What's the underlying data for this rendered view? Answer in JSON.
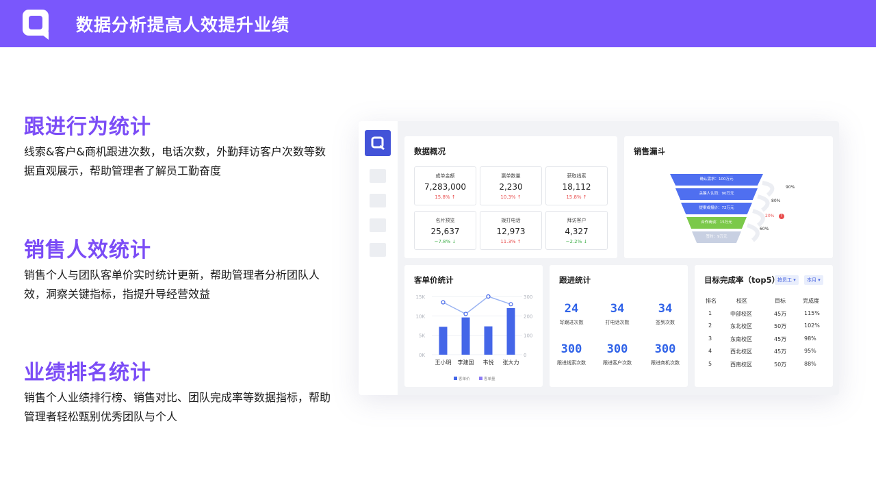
{
  "header": {
    "title": "数据分析提高人效提升业绩"
  },
  "sections": [
    {
      "title": "跟进行为统计",
      "desc": "线索&客户&商机跟进次数，电话次数，外勤拜访客户次数等数据直观展示，帮助管理者了解员工勤奋度"
    },
    {
      "title": "销售人效统计",
      "desc": "销售个人与团队客单价实时统计更新，帮助管理者分析团队人效，洞察关键指标，指提升导经营效益"
    },
    {
      "title": "业绩排名统计",
      "desc": "销售个人业绩排行榜、销售对比、团队完成率等数据指标，帮助管理者轻松甄别优秀团队与个人"
    }
  ],
  "overview": {
    "title": "数据概况",
    "kpis": [
      {
        "label": "成单金额",
        "value": "7,283,000",
        "change": "15.8%",
        "dir": "up"
      },
      {
        "label": "赢单数量",
        "value": "2,230",
        "change": "10.3%",
        "dir": "up"
      },
      {
        "label": "获取线索",
        "value": "18,112",
        "change": "15.8%",
        "dir": "up"
      },
      {
        "label": "名片预览",
        "value": "25,637",
        "change": "−7.8%",
        "dir": "down"
      },
      {
        "label": "拨打电话",
        "value": "12,973",
        "change": "11.3%",
        "dir": "up"
      },
      {
        "label": "拜访客户",
        "value": "4,327",
        "change": "−2.2%",
        "dir": "down"
      }
    ]
  },
  "funnel": {
    "title": "销售漏斗",
    "stages": [
      {
        "label": "确认需求：100万元",
        "color": "#4f6ff0"
      },
      {
        "label": "关键人认同：90万元",
        "color": "#4f6ff0"
      },
      {
        "label": "提案或报价：72万元",
        "color": "#4f6ff0"
      },
      {
        "label": "合作商谈：15万元",
        "color": "#7bc94a"
      },
      {
        "label": "签约：9万元",
        "color": "#c8d0e2"
      }
    ],
    "percents": [
      "90%",
      "80%",
      "20%",
      "60%"
    ]
  },
  "chart_data": {
    "type": "bar",
    "title": "客单价统计",
    "categories": [
      "王小明",
      "李建国",
      "韦悦",
      "张大力"
    ],
    "series": [
      {
        "name": "客单价",
        "type": "bar",
        "axis": "left",
        "values": [
          7200,
          9600,
          7300,
          12000
        ],
        "color": "#4466e8"
      },
      {
        "name": "客单量",
        "type": "line",
        "axis": "right",
        "values": [
          270,
          210,
          300,
          260
        ],
        "color": "#9bb4f2"
      }
    ],
    "yleft_ticks": [
      "15K",
      "10K",
      "5K",
      "0K"
    ],
    "yright_ticks": [
      "300",
      "200",
      "100",
      "0"
    ],
    "ylim_left": [
      0,
      15000
    ],
    "ylim_right": [
      0,
      300
    ]
  },
  "followup": {
    "title": "跟进统计",
    "items": [
      {
        "value": "24",
        "label": "写跟进次数"
      },
      {
        "value": "34",
        "label": "打电话次数"
      },
      {
        "value": "34",
        "label": "签到次数"
      },
      {
        "value": "300",
        "label": "跟进线索次数"
      },
      {
        "value": "300",
        "label": "跟进客户次数"
      },
      {
        "value": "300",
        "label": "跟进商机次数"
      }
    ]
  },
  "target": {
    "title": "目标完成率（top5）",
    "filter1": "按员工",
    "filter2": "本月",
    "headers": [
      "排名",
      "校区",
      "目标",
      "完成度"
    ],
    "rows": [
      [
        "1",
        "中部校区",
        "45万",
        "115%"
      ],
      [
        "2",
        "东北校区",
        "50万",
        "102%"
      ],
      [
        "3",
        "东南校区",
        "45万",
        "98%"
      ],
      [
        "4",
        "西北校区",
        "45万",
        "95%"
      ],
      [
        "5",
        "西南校区",
        "50万",
        "88%"
      ]
    ]
  }
}
